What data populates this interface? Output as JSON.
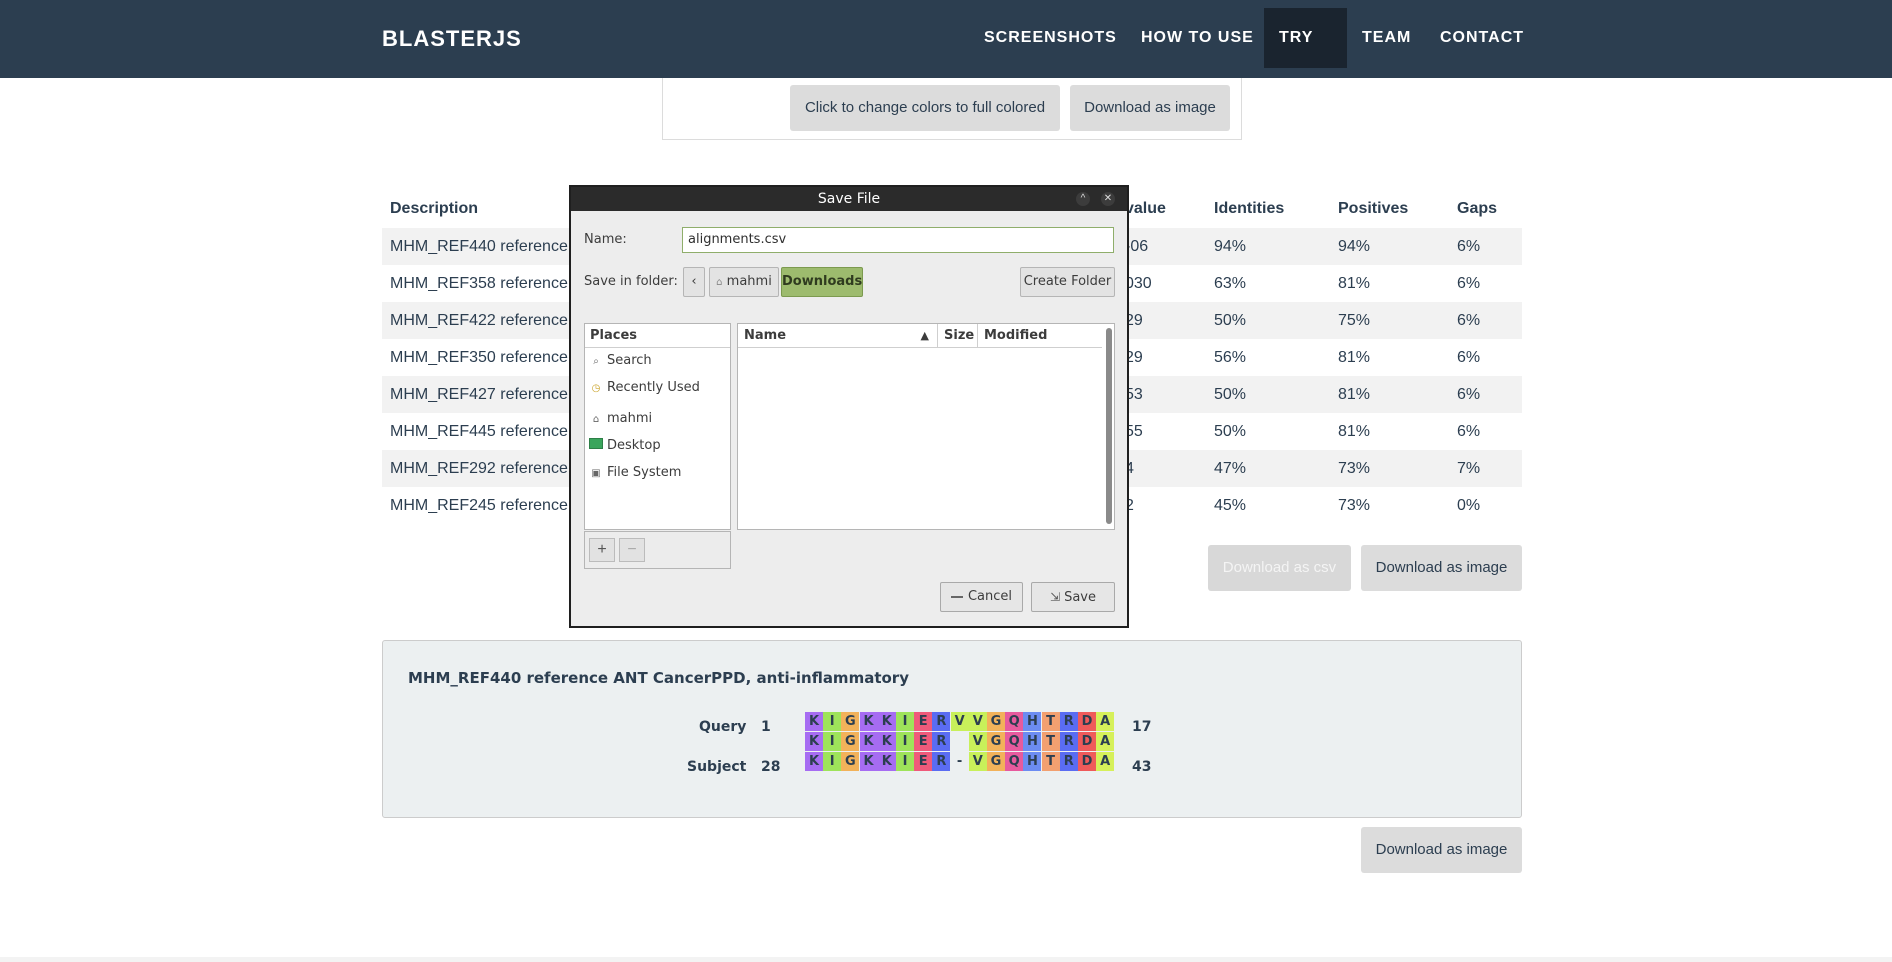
{
  "nav": {
    "brand": "BLASTERJS",
    "items": [
      {
        "label": "SCREENSHOTS"
      },
      {
        "label": "HOW TO USE"
      },
      {
        "label": "TRY IT"
      },
      {
        "label": "TEAM"
      },
      {
        "label": "CONTACT"
      }
    ],
    "active": "TRY IT"
  },
  "top_buttons": {
    "change_colors": "Click to change colors to full colored",
    "download_image": "Download as image"
  },
  "table": {
    "headers": [
      "Description",
      "value",
      "Identities",
      "Positives",
      "Gaps"
    ],
    "rows": [
      {
        "desc": "MHM_REF440 reference A",
        "evalue": "-06",
        "identities": "94%",
        "positives": "94%",
        "gaps": "6%"
      },
      {
        "desc": "MHM_REF358 reference A",
        "evalue": "030",
        "identities": "63%",
        "positives": "81%",
        "gaps": "6%"
      },
      {
        "desc": "MHM_REF422 reference IN",
        "evalue": "29",
        "identities": "50%",
        "positives": "75%",
        "gaps": "6%"
      },
      {
        "desc": "MHM_REF350 reference A",
        "evalue": "29",
        "identities": "56%",
        "positives": "81%",
        "gaps": "6%"
      },
      {
        "desc": "MHM_REF427 reference A",
        "evalue": "53",
        "identities": "50%",
        "positives": "81%",
        "gaps": "6%"
      },
      {
        "desc": "MHM_REF445 reference A",
        "evalue": "55",
        "identities": "50%",
        "positives": "81%",
        "gaps": "6%"
      },
      {
        "desc": "MHM_REF292 reference A",
        "evalue": "4",
        "identities": "47%",
        "positives": "73%",
        "gaps": "7%"
      },
      {
        "desc": "MHM_REF245 reference A",
        "evalue": "2",
        "identities": "45%",
        "positives": "73%",
        "gaps": "0%"
      }
    ],
    "download_csv": "Download as csv",
    "download_image": "Download as image"
  },
  "alignment": {
    "title": "MHM_REF440 reference ANT CancerPPD, anti-inflammatory",
    "query_label": "Query",
    "query_start": "1",
    "query_end": "17",
    "subject_label": "Subject",
    "subject_start": "28",
    "subject_end": "43",
    "query_seq": [
      "K",
      "I",
      "G",
      "K",
      "K",
      "I",
      "E",
      "R",
      "V",
      "V",
      "G",
      "Q",
      "H",
      "T",
      "R",
      "D",
      "A"
    ],
    "match_seq": [
      "K",
      "I",
      "G",
      "K",
      "K",
      "I",
      "E",
      "R",
      "",
      "V",
      "G",
      "Q",
      "H",
      "T",
      "R",
      "D",
      "A"
    ],
    "subject_seq": [
      "K",
      "I",
      "G",
      "K",
      "K",
      "I",
      "E",
      "R",
      "-",
      "V",
      "G",
      "Q",
      "H",
      "T",
      "R",
      "D",
      "A"
    ],
    "colors": [
      "#a66cf2",
      "#9ee35a",
      "#f2b25a",
      "#a66cf2",
      "#a66cf2",
      "#9ee35a",
      "#ef5a7a",
      "#5a6cf2",
      "#c8f05a",
      "#c8f05a",
      "#f2b25a",
      "#e75a9e",
      "#6c8cf2",
      "#f2a070",
      "#5a6cf2",
      "#ef5a5a",
      "#d6f05a"
    ],
    "download_image": "Download as image"
  },
  "dialog": {
    "title": "Save File",
    "name_label": "Name:",
    "name_value": "alignments.csv",
    "folder_label": "Save in folder:",
    "path": [
      "mahmi",
      "Downloads"
    ],
    "create_folder": "Create Folder",
    "places_header": "Places",
    "places": [
      {
        "label": "Search",
        "icon": "search-icon"
      },
      {
        "label": "Recently Used",
        "icon": "clock-icon"
      },
      {
        "label": "mahmi",
        "icon": "home-icon"
      },
      {
        "label": "Desktop",
        "icon": "desktop-icon"
      },
      {
        "label": "File System",
        "icon": "drive-icon"
      }
    ],
    "columns": [
      "Name",
      "Size",
      "Modified"
    ],
    "cancel": "Cancel",
    "save": "Save"
  }
}
